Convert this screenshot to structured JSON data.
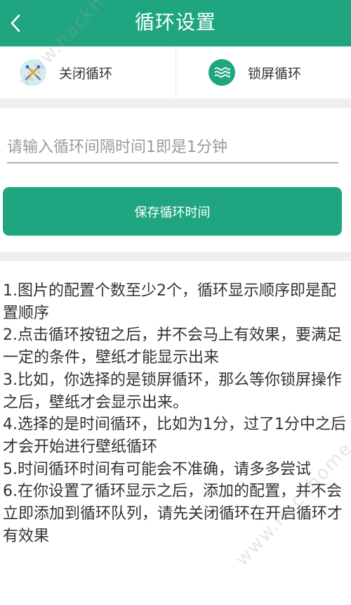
{
  "header": {
    "title": "循环设置"
  },
  "modes": [
    {
      "label": "关闭循环",
      "icon": "crossed-tools-icon"
    },
    {
      "label": "锁屏循环",
      "icon": "waves-icon"
    }
  ],
  "form": {
    "interval_placeholder": "请输入循环间隔时间1即是1分钟",
    "save_label": "保存循环时间"
  },
  "notes": [
    "1.图片的配置个数至少2个，循环显示顺序即是配置顺序",
    "2.点击循环按钮之后，并不会马上有效果，要满足一定的条件，壁纸才能显示出来",
    "3.比如，你选择的是锁屏循环，那么等你锁屏操作之后，壁纸才会显示出来。",
    "4.选择的是时间循环，比如为1分，过了1分中之后才会开始进行壁纸循环",
    "5.时间循环时间有可能会不准确，请多多尝试",
    "6.在你设置了循环显示之后，添加的配置，并不会立即添加到循环队列，请先关闭循环在开启循环才有效果"
  ],
  "watermark": "www.hackhome.com",
  "colors": {
    "accent": "#1fa580",
    "divider": "#efefef"
  }
}
